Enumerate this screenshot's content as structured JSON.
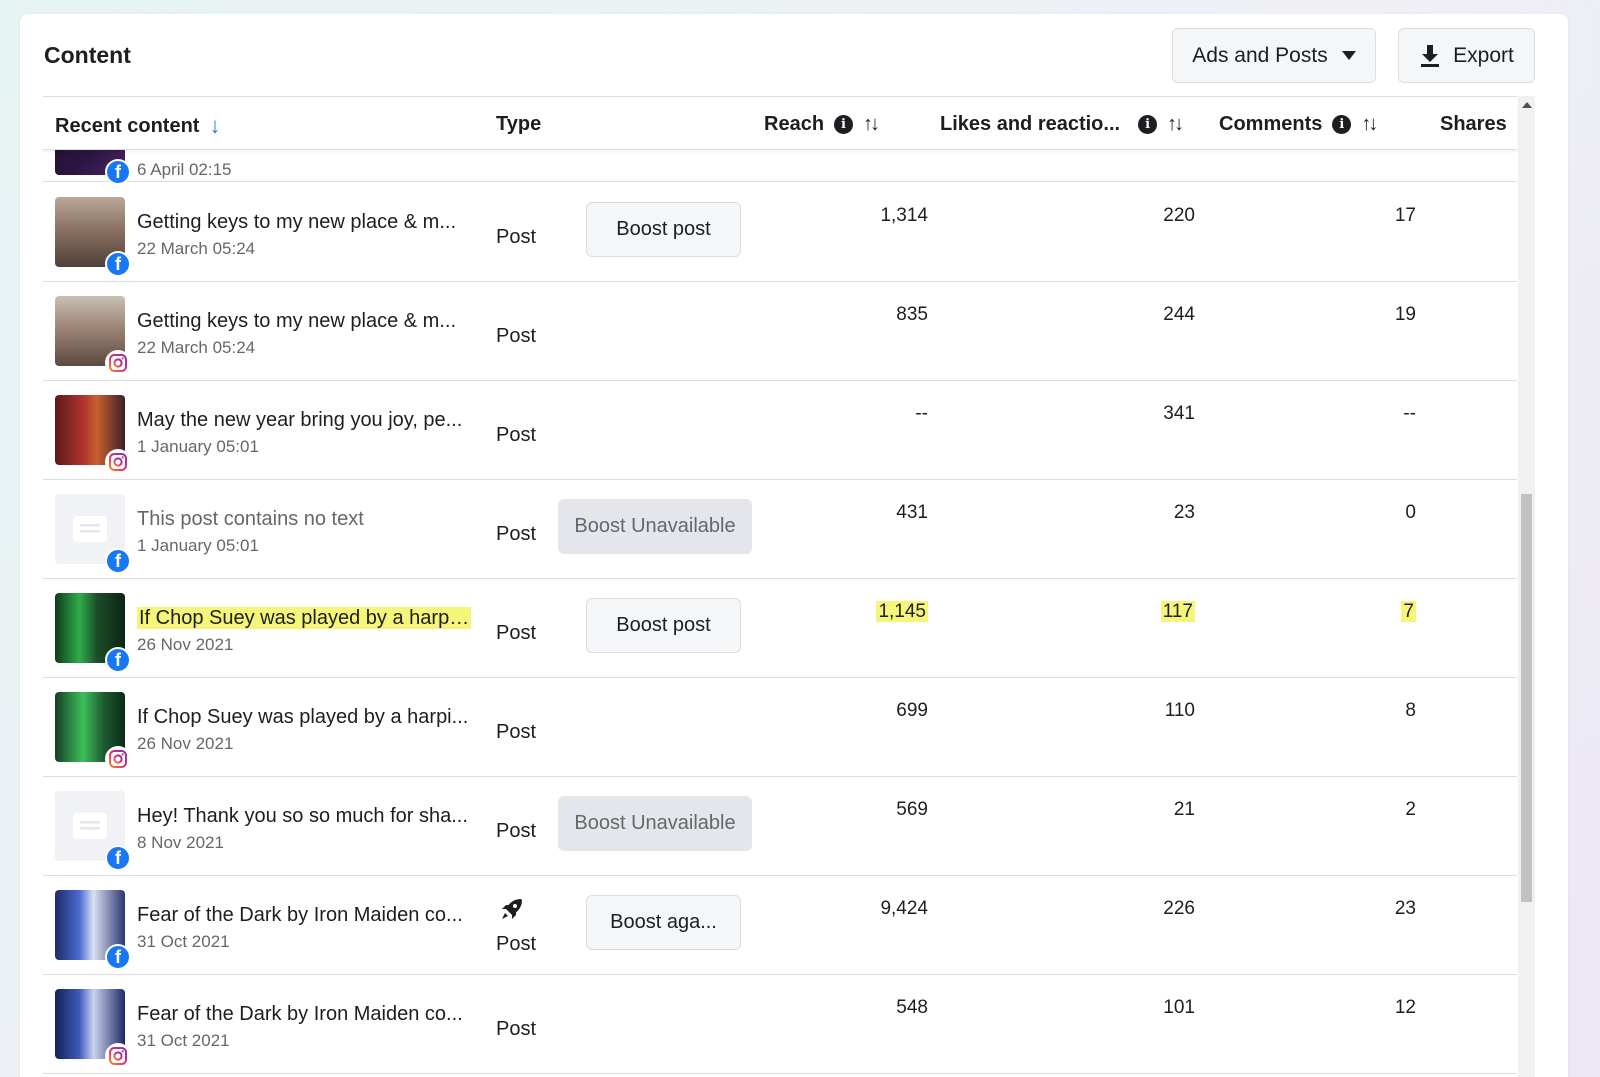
{
  "header": {
    "title": "Content",
    "filter_label": "Ads and Posts",
    "export_label": "Export"
  },
  "columns": {
    "recent": "Recent content",
    "type": "Type",
    "reach": "Reach",
    "likes": "Likes and reactio...",
    "comments": "Comments",
    "shares": "Shares"
  },
  "partial_row": {
    "date": "6 April 02:15",
    "platform": "facebook"
  },
  "rows": [
    {
      "title": "Getting keys to my new place & m...",
      "date": "22 March 05:24",
      "platform": "facebook",
      "type": "Post",
      "action": "Boost post",
      "reach": "1,314",
      "likes": "220",
      "comments": "17"
    },
    {
      "title": "Getting keys to my new place & m...",
      "date": "22 March 05:24",
      "platform": "instagram",
      "type": "Post",
      "action": "",
      "reach": "835",
      "likes": "244",
      "comments": "19"
    },
    {
      "title": "May the new year bring you joy, pe...",
      "date": "1 January 05:01",
      "platform": "instagram",
      "type": "Post",
      "action": "",
      "reach": "--",
      "likes": "341",
      "comments": "--"
    },
    {
      "title": "This post contains no text",
      "date": "1 January 05:01",
      "platform": "facebook",
      "type": "Post",
      "action": "Boost Unavailable",
      "reach": "431",
      "likes": "23",
      "comments": "0"
    },
    {
      "title": "If Chop Suey was played by a harpi...",
      "date": "26 Nov 2021",
      "platform": "facebook",
      "type": "Post",
      "action": "Boost post",
      "reach": "1,145",
      "likes": "117",
      "comments": "7"
    },
    {
      "title": "If Chop Suey was played by a harpi...",
      "date": "26 Nov 2021",
      "platform": "instagram",
      "type": "Post",
      "action": "",
      "reach": "699",
      "likes": "110",
      "comments": "8"
    },
    {
      "title": "Hey! Thank you so so much for sha...",
      "date": "8 Nov 2021",
      "platform": "facebook",
      "type": "Post",
      "action": "Boost Unavailable",
      "reach": "569",
      "likes": "21",
      "comments": "2"
    },
    {
      "title": "Fear of the Dark by Iron Maiden co...",
      "date": "31 Oct 2021",
      "platform": "facebook",
      "type": "Post",
      "action": "Boost aga...",
      "reach": "9,424",
      "likes": "226",
      "comments": "23"
    },
    {
      "title": "Fear of the Dark by Iron Maiden co...",
      "date": "31 Oct 2021",
      "platform": "instagram",
      "type": "Post",
      "action": "",
      "reach": "548",
      "likes": "101",
      "comments": "12"
    }
  ]
}
